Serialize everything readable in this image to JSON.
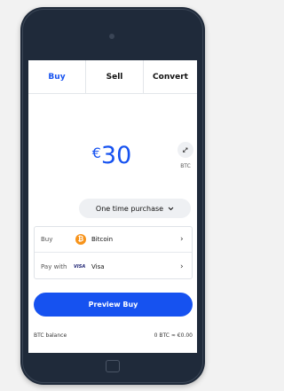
{
  "tabs": [
    {
      "label": "Buy",
      "active": true
    },
    {
      "label": "Sell",
      "active": false
    },
    {
      "label": "Convert",
      "active": false
    }
  ],
  "amount": {
    "currency_symbol": "€",
    "value": "30"
  },
  "swap": {
    "label": "BTC",
    "icon": "swap-arrows-icon"
  },
  "purchase_type": {
    "label": "One time purchase",
    "icon": "chevron-down-icon"
  },
  "asset_row": {
    "label": "Buy",
    "value": "Bitcoin",
    "icon": "bitcoin-icon",
    "icon_glyph": "₿"
  },
  "payment_row": {
    "label": "Pay with",
    "value": "Visa",
    "brand_mark": "VISA"
  },
  "chevron_glyph": "›",
  "preview_button": {
    "label": "Preview Buy"
  },
  "balance": {
    "label": "BTC balance",
    "value": "0 BTC ≈ €0.00"
  },
  "colors": {
    "accent": "#1652f0",
    "bitcoin": "#f7931a",
    "phone_frame": "#1f2a3a"
  }
}
